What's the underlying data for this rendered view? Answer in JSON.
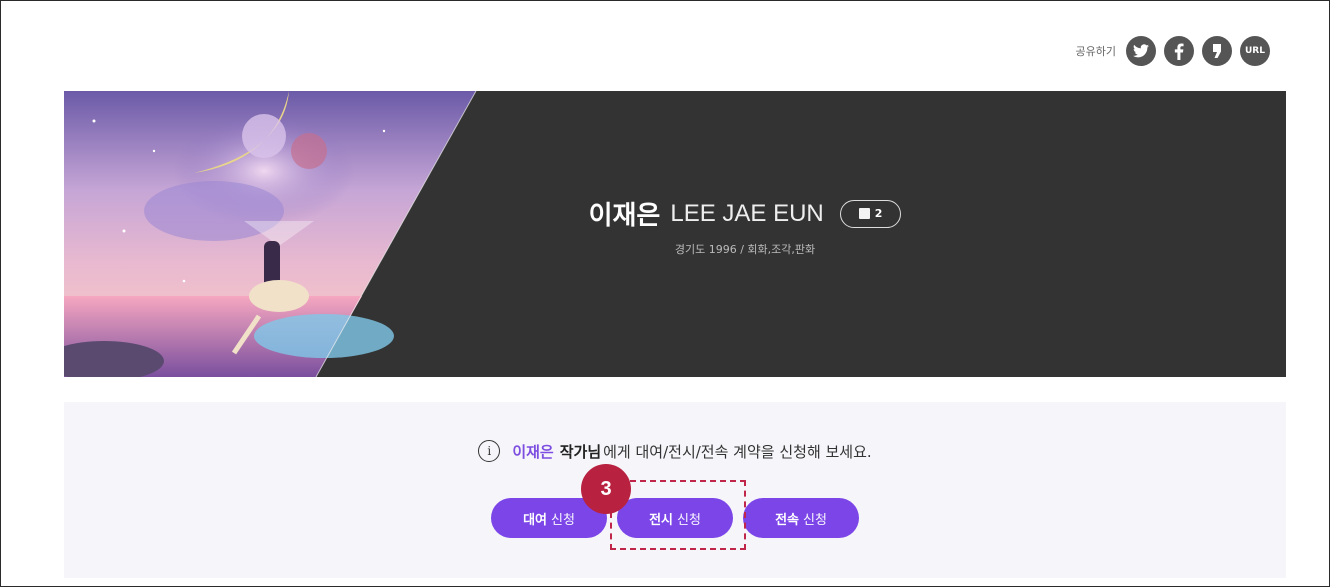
{
  "share": {
    "label": "공유하기",
    "buttons": [
      {
        "name": "twitter"
      },
      {
        "name": "facebook"
      },
      {
        "name": "kakaostory"
      },
      {
        "name": "url",
        "label": "URL"
      }
    ]
  },
  "artist": {
    "name_ko": "이재은",
    "name_en": "LEE JAE EUN",
    "works_count": "2",
    "meta": "경기도 1996 / 회화,조각,판화"
  },
  "notice": {
    "name": "이재은",
    "title": "작가님",
    "message": "에게 대여/전시/전속 계약을 신청해 보세요."
  },
  "buttons": {
    "rent": {
      "bold": "대여",
      "label": "신청"
    },
    "exhibit": {
      "bold": "전시",
      "label": "신청"
    },
    "exclusive": {
      "bold": "전속",
      "label": "신청"
    }
  },
  "annotation": {
    "step": "3"
  },
  "colors": {
    "accent": "#7b45e8",
    "banner": "#333333",
    "annotation": "#c0254a"
  }
}
